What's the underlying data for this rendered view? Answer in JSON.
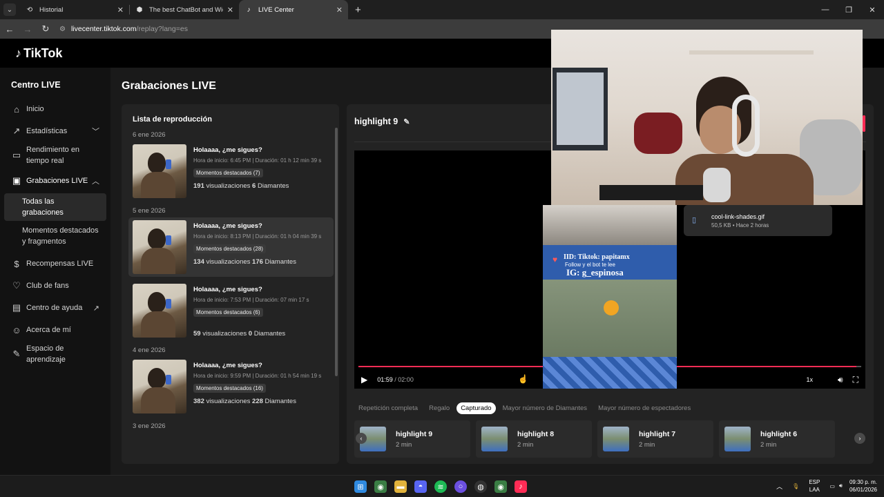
{
  "browser": {
    "tabs": [
      {
        "label": "Historial",
        "icon": "history-icon"
      },
      {
        "label": "The best ChatBot and Widgets",
        "icon": "shield-icon"
      },
      {
        "label": "LIVE Center",
        "icon": "tiktok-icon"
      }
    ],
    "new_tab": "+",
    "url_host": "livecenter.tiktok.com",
    "url_path": "/replay?lang=es"
  },
  "app": {
    "logo": "TikTok",
    "sidebar": {
      "title": "Centro LIVE",
      "items": [
        {
          "label": "Inicio",
          "icon": "home-icon"
        },
        {
          "label": "Estadísticas",
          "icon": "chart-icon"
        },
        {
          "label": "Rendimiento en tiempo real",
          "icon": "monitor-icon"
        },
        {
          "label": "Grabaciones LIVE",
          "icon": "recordings-icon"
        },
        {
          "label": "Recompensas LIVE",
          "icon": "dollar-icon"
        },
        {
          "label": "Club de fans",
          "icon": "heart-icon"
        },
        {
          "label": "Centro de ayuda",
          "icon": "book-icon"
        },
        {
          "label": "Acerca de mí",
          "icon": "user-icon"
        },
        {
          "label": "Espacio de aprendizaje",
          "icon": "learning-icon"
        }
      ],
      "sub_items": [
        "Todas las grabaciones",
        "Momentos destacados y fragmentos"
      ]
    },
    "page_title": "Grabaciones LIVE",
    "playlist": {
      "title": "Lista de reproducción",
      "groups": [
        {
          "date": "6 ene 2026",
          "records": [
            {
              "title": "Holaaaa, ¿me sigues?",
              "meta": "Hora de inicio: 6:45 PM | Duración: 01 h 12 min 39 s",
              "badge": "Momentos destacados (7)",
              "views": "191",
              "views_label": "visualizaciones",
              "diamonds": "6",
              "diamonds_label": "Diamantes"
            }
          ]
        },
        {
          "date": "5 ene 2026",
          "records": [
            {
              "title": "Holaaaa, ¿me sigues?",
              "meta": "Hora de inicio: 8:13 PM | Duración: 01 h 04 min 39 s",
              "badge": "Momentos destacados (28)",
              "views": "134",
              "views_label": "visualizaciones",
              "diamonds": "176",
              "diamonds_label": "Diamantes"
            },
            {
              "title": "Holaaaa, ¿me sigues?",
              "meta": "Hora de inicio: 7:53 PM | Duración: 07 min 17 s",
              "badge": "Momentos destacados (6)",
              "views": "59",
              "views_label": "visualizaciones",
              "diamonds": "0",
              "diamonds_label": "Diamantes"
            }
          ]
        },
        {
          "date": "4 ene 2026",
          "records": [
            {
              "title": "Holaaaa, ¿me sigues?",
              "meta": "Hora de inicio: 9:59 PM | Duración: 01 h 54 min 19 s",
              "badge": "Momentos destacados (16)",
              "views": "382",
              "views_label": "visualizaciones",
              "diamonds": "228",
              "diamonds_label": "Diamantes"
            }
          ]
        },
        {
          "date": "3 ene 2026",
          "records": []
        }
      ]
    },
    "player": {
      "title": "highlight 9",
      "current_time": "01:59",
      "total_time": "02:00",
      "progress": 0.99,
      "speed": "1x",
      "filters": [
        "Repetición completa",
        "Regalo",
        "Capturado",
        "Mayor número de Diamantes",
        "Mayor número de espectadores"
      ],
      "active_filter": "Capturado",
      "highlights": [
        {
          "name": "highlight 9",
          "duration": "2 min"
        },
        {
          "name": "highlight 8",
          "duration": "2 min"
        },
        {
          "name": "highlight 7",
          "duration": "2 min"
        },
        {
          "name": "highlight 6",
          "duration": "2 min"
        }
      ]
    }
  },
  "overlay": {
    "stream_line1": "IID: Tiktok: papitamx",
    "stream_line2": "Follow y el bot te lee",
    "stream_line3": "IG: g_espinosa",
    "download_name": "cool-link-shades.gif",
    "download_meta": "50,5 KB • Hace 2 horas"
  },
  "taskbar": {
    "lang_top": "ESP",
    "lang_bottom": "LAA",
    "time": "09:30 p. m.",
    "date": "06/01/2026"
  },
  "colors": {
    "accent": "#fe2c55",
    "background": "#121212"
  }
}
